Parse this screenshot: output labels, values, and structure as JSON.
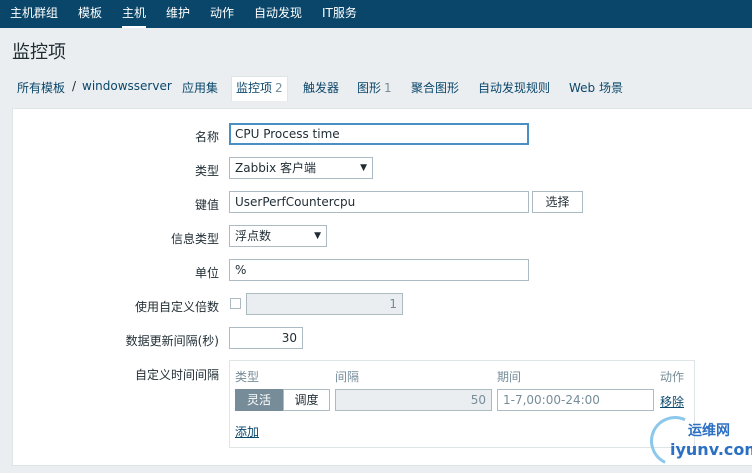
{
  "topnav": {
    "items": [
      "主机群组",
      "模板",
      "主机",
      "维护",
      "动作",
      "自动发现",
      "IT服务"
    ]
  },
  "page": {
    "title": "监控项"
  },
  "breadcrumb": {
    "all_templates": "所有模板",
    "sep": "/",
    "host": "windowsserver"
  },
  "tabs": {
    "applications": "应用集",
    "items": "监控项",
    "items_count": "2",
    "triggers": "触发器",
    "graphs": "图形",
    "graphs_count": "1",
    "screens": "聚合图形",
    "discovery": "自动发现规则",
    "web": "Web 场景"
  },
  "form": {
    "name_label": "名称",
    "name_value": "CPU Process time",
    "type_label": "类型",
    "type_value": "Zabbix 客户端",
    "key_label": "键值",
    "key_value": "UserPerfCountercpu",
    "key_select_button": "选择",
    "info_type_label": "信息类型",
    "info_type_value": "浮点数",
    "units_label": "单位",
    "units_value": "%",
    "multiplier_label": "使用自定义倍数",
    "multiplier_value": "1",
    "interval_label": "数据更新间隔(秒)",
    "interval_value": "30",
    "custom_intervals_label": "自定义时间间隔"
  },
  "custom_intervals": {
    "col_type": "类型",
    "col_interval": "间隔",
    "col_period": "期间",
    "col_action": "动作",
    "flexible": "灵活",
    "scheduling": "调度",
    "interval_value": "50",
    "period_placeholder": "1-7,00:00-24:00",
    "remove": "移除",
    "add": "添加"
  },
  "watermark": {
    "text1": "运维网",
    "text2": "iyunv.com"
  },
  "icons": {
    "dropdown": "triangle-down"
  }
}
